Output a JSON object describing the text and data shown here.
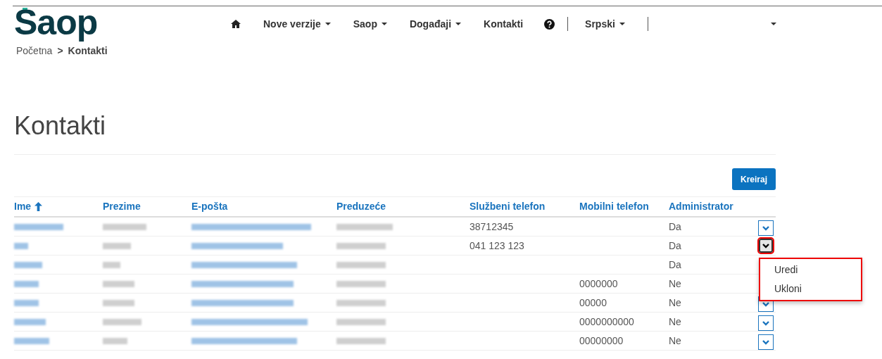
{
  "logo": {
    "text": "Saop"
  },
  "nav": {
    "items": [
      {
        "kind": "home"
      },
      {
        "kind": "menu",
        "label": "Nove verzije"
      },
      {
        "kind": "menu",
        "label": "Saop"
      },
      {
        "kind": "menu",
        "label": "Događaji"
      },
      {
        "kind": "link",
        "label": "Kontakti"
      },
      {
        "kind": "help"
      },
      {
        "kind": "divider"
      },
      {
        "kind": "menu",
        "label": "Srpski"
      },
      {
        "kind": "divider"
      }
    ]
  },
  "breadcrumb": [
    {
      "label": "Početna",
      "selected": false
    },
    {
      "label": "Kontakti",
      "selected": true
    }
  ],
  "breadcrumb_separator": ">",
  "page_title": "Kontakti",
  "create_button": "Kreiraj",
  "table": {
    "columns": [
      {
        "label": "Ime",
        "sorted": true
      },
      {
        "label": "Prezime",
        "sorted": false
      },
      {
        "label": "E-pošta",
        "sorted": false
      },
      {
        "label": "Preduzeće",
        "sorted": false
      },
      {
        "label": "Službeni telefon",
        "sorted": false
      },
      {
        "label": "Mobilni telefon",
        "sorted": false
      },
      {
        "label": "Administrator",
        "sorted": false
      }
    ],
    "rows": [
      {
        "work_phone": "38712345",
        "mobile_phone": "",
        "administrator": "Da",
        "menu_open": false
      },
      {
        "work_phone": "041 123 123",
        "mobile_phone": "",
        "administrator": "Da",
        "menu_open": true
      },
      {
        "work_phone": "",
        "mobile_phone": "",
        "administrator": "Da",
        "menu_open": false
      },
      {
        "work_phone": "",
        "mobile_phone": "0000000",
        "administrator": "Ne",
        "menu_open": false
      },
      {
        "work_phone": "",
        "mobile_phone": "00000",
        "administrator": "Ne",
        "menu_open": false
      },
      {
        "work_phone": "",
        "mobile_phone": "0000000000",
        "administrator": "Ne",
        "menu_open": false
      },
      {
        "work_phone": "",
        "mobile_phone": "00000000",
        "administrator": "Ne",
        "menu_open": false
      }
    ]
  },
  "row_menu": {
    "items": [
      "Uredi",
      "Ukloni"
    ]
  }
}
